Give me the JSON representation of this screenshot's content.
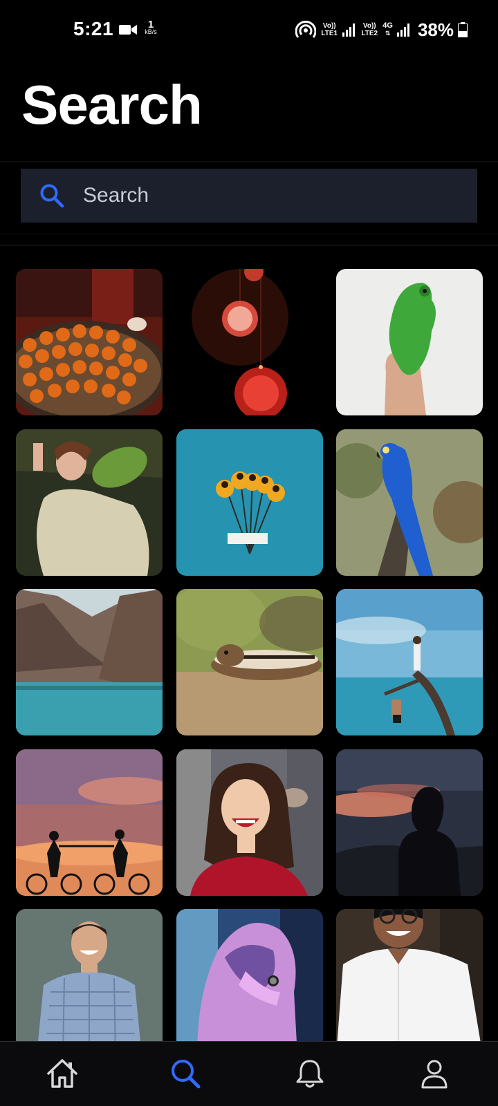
{
  "status_bar": {
    "time": "5:21",
    "speed_value": "1",
    "speed_unit": "kB/s",
    "sim1": "Vo)) LTE1",
    "sim2": "Vo)) LTE2",
    "network": "4G",
    "battery": "38%"
  },
  "header": {
    "title": "Search"
  },
  "search": {
    "placeholder": "Search",
    "value": ""
  },
  "grid": {
    "tiles": [
      {
        "subject": "persimmons-basket"
      },
      {
        "subject": "red-lanterns"
      },
      {
        "subject": "chameleon-on-hand"
      },
      {
        "subject": "woman-lying-with-leaf"
      },
      {
        "subject": "yellow-flowers-on-blue"
      },
      {
        "subject": "blue-macaw"
      },
      {
        "subject": "mountain-lake"
      },
      {
        "subject": "chipmunk"
      },
      {
        "subject": "couple-on-tree-by-sea"
      },
      {
        "subject": "cyclists-at-sunset"
      },
      {
        "subject": "smiling-woman"
      },
      {
        "subject": "silhouette-at-dusk"
      },
      {
        "subject": "smiling-man-checked-shirt"
      },
      {
        "subject": "hooded-person-neon"
      },
      {
        "subject": "man-with-glasses-white-shirt"
      }
    ]
  },
  "bottom_nav": {
    "items": [
      {
        "icon": "home-icon",
        "active": false
      },
      {
        "icon": "search-icon",
        "active": true
      },
      {
        "icon": "bell-icon",
        "active": false
      },
      {
        "icon": "profile-icon",
        "active": false
      }
    ],
    "active_color": "#2f6bff",
    "inactive_color": "#d8d8d8"
  },
  "colors": {
    "background": "#000000",
    "search_bar": "#1c202c",
    "accent": "#2f6bff"
  }
}
